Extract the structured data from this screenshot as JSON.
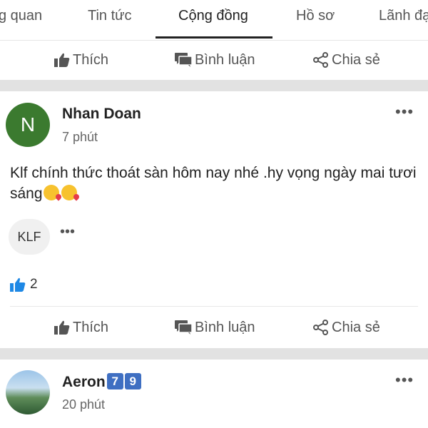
{
  "tabs": [
    {
      "label": "g quan"
    },
    {
      "label": "Tin tức"
    },
    {
      "label": "Cộng đồng"
    },
    {
      "label": "Hồ sơ"
    },
    {
      "label": "Lãnh đạ"
    }
  ],
  "actions": {
    "like": "Thích",
    "comment": "Bình luận",
    "share": "Chia sẻ"
  },
  "post": {
    "author": "Nhan Doan",
    "avatar_letter": "N",
    "time": "7 phút",
    "content": "Klf chính thức thoát sàn hôm nay nhé .hy vọng ngày mai tươi sáng",
    "tag": "KLF",
    "like_count": "2"
  },
  "post2": {
    "author": "Aeron",
    "badge_1": "7",
    "badge_2": "9",
    "time": "20 phút"
  },
  "colors": {
    "like_blue": "#1e88e5",
    "avatar_green": "#3b7a2f",
    "badge_blue": "#3f6fc2",
    "separator": "#e2e2e2"
  }
}
